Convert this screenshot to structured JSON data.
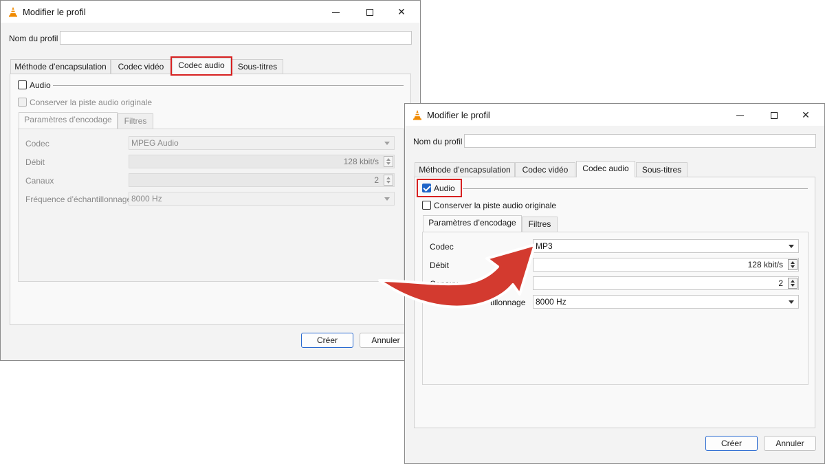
{
  "colors": {
    "highlight": "#d72020",
    "arrow": "#d33a2f",
    "accent": "#1f65c8"
  },
  "window_left": {
    "title": "Modifier le profil",
    "profile_label": "Nom du profil",
    "profile_value": "",
    "tabs": [
      "Méthode d’encapsulation",
      "Codec vidéo",
      "Codec audio",
      "Sous-titres"
    ],
    "active_tab": "Codec audio",
    "audio_checkbox": {
      "label": "Audio",
      "checked": false
    },
    "keep_track_checkbox": {
      "label": "Conserver la piste audio originale",
      "checked": false
    },
    "subtabs": [
      "Paramètres d’encodage",
      "Filtres"
    ],
    "fields": {
      "codec_label": "Codec",
      "codec_value": "MPEG Audio",
      "bitrate_label": "Débit",
      "bitrate_value": "128 kbit/s",
      "channels_label": "Canaux",
      "channels_value": "2",
      "samplerate_label": "Fréquence d’échantillonnage",
      "samplerate_value": "8000 Hz"
    },
    "buttons": {
      "create": "Créer",
      "cancel": "Annuler"
    }
  },
  "window_right": {
    "title": "Modifier le profil",
    "profile_label": "Nom du profil",
    "profile_value": "",
    "tabs": [
      "Méthode d’encapsulation",
      "Codec vidéo",
      "Codec audio",
      "Sous-titres"
    ],
    "active_tab": "Codec audio",
    "audio_checkbox": {
      "label": "Audio",
      "checked": true
    },
    "keep_track_checkbox": {
      "label": "Conserver la piste audio originale",
      "checked": false
    },
    "subtabs": [
      "Paramètres d’encodage",
      "Filtres"
    ],
    "fields": {
      "codec_label": "Codec",
      "codec_value": "MP3",
      "bitrate_label": "Débit",
      "bitrate_value": "128 kbit/s",
      "channels_label": "Canaux",
      "channels_value": "2",
      "samplerate_label_visible": "tillonnage",
      "samplerate_value": "8000 Hz"
    },
    "buttons": {
      "create": "Créer",
      "cancel": "Annuler"
    }
  }
}
